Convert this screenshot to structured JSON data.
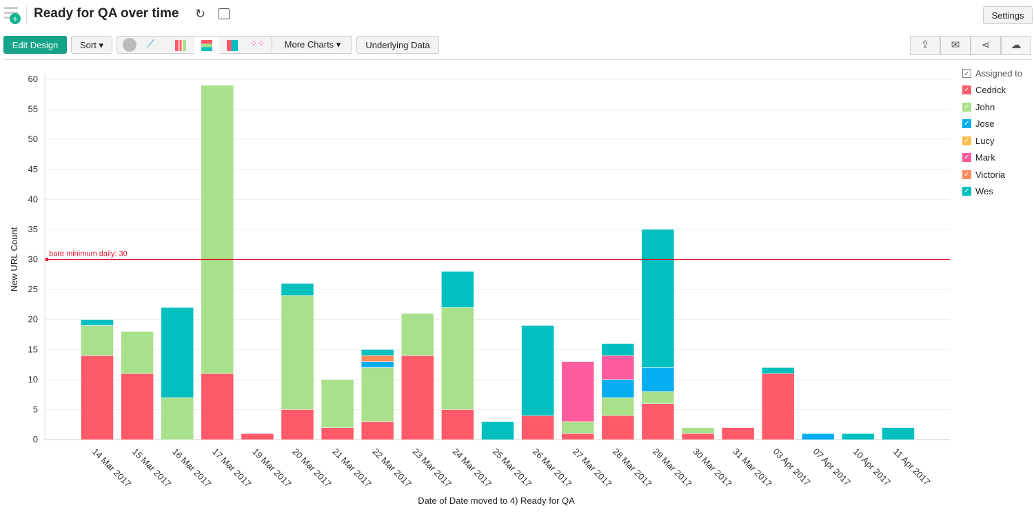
{
  "header": {
    "title": "Ready for QA over time",
    "settings_label": "Settings"
  },
  "toolbar": {
    "edit_design": "Edit Design",
    "sort": "Sort",
    "more_charts": "More Charts",
    "underlying_data": "Underlying Data"
  },
  "legend": {
    "title": "Assigned to"
  },
  "chart_data": {
    "type": "bar",
    "stacked": true,
    "xlabel": "Date of Date moved to 4) Ready for QA",
    "ylabel": "New URL Count",
    "ylim": [
      0,
      60
    ],
    "yticks": [
      0,
      5,
      10,
      15,
      20,
      25,
      30,
      35,
      40,
      45,
      50,
      55,
      60
    ],
    "grid": true,
    "legend_placement": "right",
    "reference_line": {
      "value": 30,
      "label": "bare minimum daily: 30",
      "color": "#e0112b"
    },
    "categories": [
      "14 Mar 2017",
      "15 Mar 2017",
      "16 Mar 2017",
      "17 Mar 2017",
      "19 Mar 2017",
      "20 Mar 2017",
      "21 Mar 2017",
      "22 Mar 2017",
      "23 Mar 2017",
      "24 Mar 2017",
      "25 Mar 2017",
      "26 Mar 2017",
      "27 Mar 2017",
      "28 Mar 2017",
      "29 Mar 2017",
      "30 Mar 2017",
      "31 Mar 2017",
      "03 Apr 2017",
      "07 Apr 2017",
      "10 Apr 2017",
      "11 Apr 2017"
    ],
    "series": [
      {
        "name": "Cedrick",
        "color": "#ff5a69",
        "values": [
          14,
          11,
          0,
          11,
          1,
          5,
          2,
          3,
          14,
          5,
          0,
          4,
          1,
          4,
          6,
          1,
          2,
          11,
          0,
          0,
          0
        ]
      },
      {
        "name": "John",
        "color": "#a8e08c",
        "values": [
          5,
          7,
          7,
          48,
          0,
          19,
          8,
          9,
          7,
          17,
          0,
          0,
          2,
          3,
          2,
          1,
          0,
          0,
          0,
          0,
          0
        ]
      },
      {
        "name": "Jose",
        "color": "#05aef0",
        "values": [
          0,
          0,
          0,
          0,
          0,
          0,
          0,
          1,
          0,
          0,
          0,
          0,
          0,
          3,
          4,
          0,
          0,
          0,
          1,
          0,
          0
        ]
      },
      {
        "name": "Lucy",
        "color": "#ffbe4f",
        "values": [
          0,
          0,
          0,
          0,
          0,
          0,
          0,
          0,
          0,
          0,
          0,
          0,
          0,
          0,
          0,
          0,
          0,
          0,
          0,
          0,
          0
        ]
      },
      {
        "name": "Mark",
        "color": "#ff5c9d",
        "values": [
          0,
          0,
          0,
          0,
          0,
          0,
          0,
          0,
          0,
          0,
          0,
          0,
          10,
          4,
          0,
          0,
          0,
          0,
          0,
          0,
          0
        ]
      },
      {
        "name": "Victoria",
        "color": "#ff8a5c",
        "values": [
          0,
          0,
          0,
          0,
          0,
          0,
          0,
          1,
          0,
          0,
          0,
          0,
          0,
          0,
          0,
          0,
          0,
          0,
          0,
          0,
          0
        ]
      },
      {
        "name": "Wes",
        "color": "#00bfbf",
        "values": [
          1,
          0,
          15,
          0,
          0,
          2,
          0,
          1,
          0,
          6,
          3,
          15,
          0,
          2,
          23,
          0,
          0,
          1,
          0,
          1,
          2
        ]
      }
    ]
  }
}
